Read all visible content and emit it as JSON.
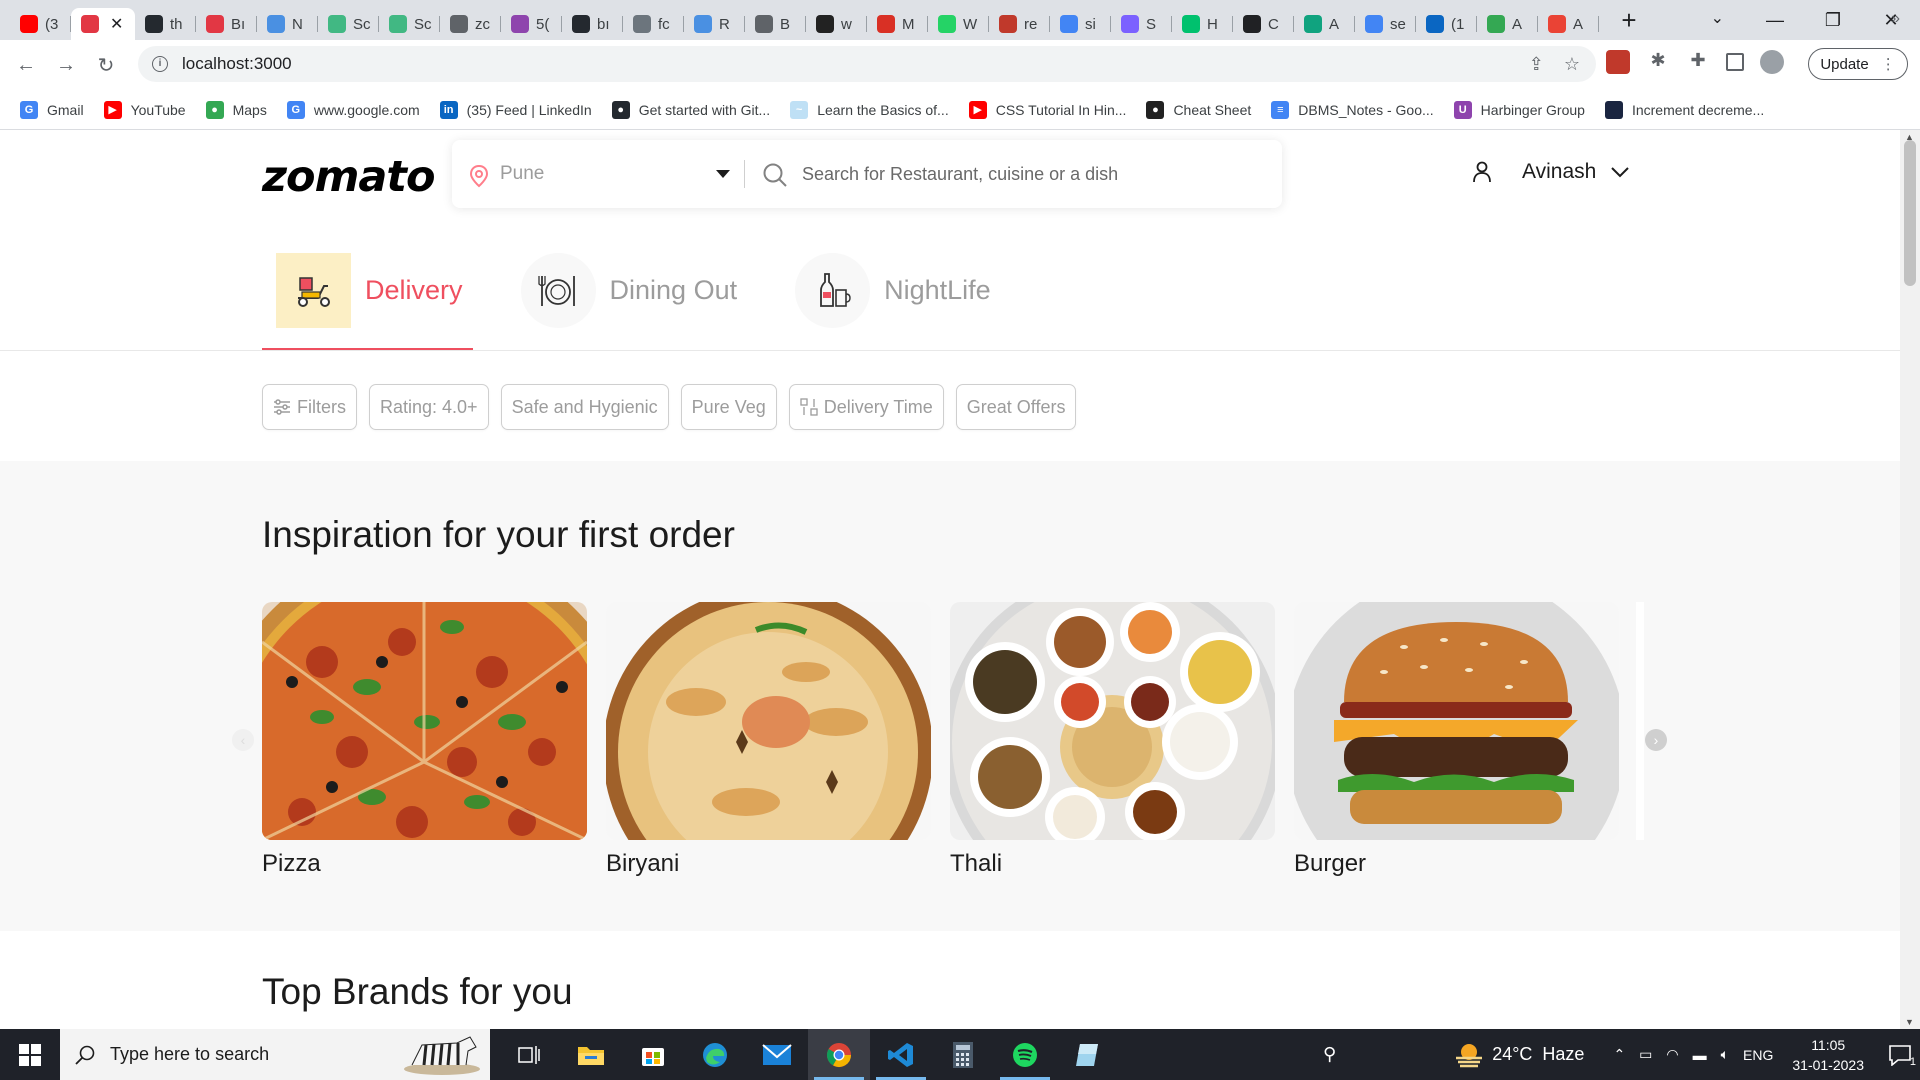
{
  "browser": {
    "tabs": [
      {
        "icon": "youtube-icon",
        "title": "(3",
        "color": "#ff0000"
      },
      {
        "icon": "zomato-icon",
        "title": "",
        "color": "#e23744",
        "active": true
      },
      {
        "icon": "github-icon",
        "title": "th",
        "color": "#24292f"
      },
      {
        "icon": "zomato-icon",
        "title": "Bı",
        "color": "#e23744"
      },
      {
        "icon": "multicolor-icon",
        "title": "N",
        "color": "#4a90e2"
      },
      {
        "icon": "vue-icon",
        "title": "Sc",
        "color": "#41b883"
      },
      {
        "icon": "vue-icon",
        "title": "Sc",
        "color": "#41b883"
      },
      {
        "icon": "globe-icon",
        "title": "zc",
        "color": "#5f6368"
      },
      {
        "icon": "purple-icon",
        "title": "5(",
        "color": "#8e44ad"
      },
      {
        "icon": "github-icon",
        "title": "bı",
        "color": "#24292f"
      },
      {
        "icon": "code-icon",
        "title": "fc",
        "color": "#6c757d"
      },
      {
        "icon": "multicolor-icon",
        "title": "R",
        "color": "#4a90e2"
      },
      {
        "icon": "globe-icon",
        "title": "B",
        "color": "#5f6368"
      },
      {
        "icon": "dark-icon",
        "title": "w",
        "color": "#222222"
      },
      {
        "icon": "red-outline-icon",
        "title": "M",
        "color": "#d93025"
      },
      {
        "icon": "whatsapp-icon",
        "title": "W",
        "color": "#25d366"
      },
      {
        "icon": "red-square-icon",
        "title": "re",
        "color": "#c0392b"
      },
      {
        "icon": "google-icon",
        "title": "si",
        "color": "#4285f4"
      },
      {
        "icon": "stack-icon",
        "title": "S",
        "color": "#7b61ff"
      },
      {
        "icon": "green-square-icon",
        "title": "H",
        "color": "#00c16e"
      },
      {
        "icon": "openai-icon",
        "title": "C",
        "color": "#202124"
      },
      {
        "icon": "openai-icon",
        "title": "A",
        "color": "#10a37f"
      },
      {
        "icon": "google-icon",
        "title": "se",
        "color": "#4285f4"
      },
      {
        "icon": "linkedin-icon",
        "title": "(1",
        "color": "#0a66c2"
      },
      {
        "icon": "drive-icon",
        "title": "A",
        "color": "#34a853"
      },
      {
        "icon": "gmail-icon",
        "title": "A",
        "color": "#ea4335"
      }
    ],
    "url": "localhost:3000",
    "update_label": "Update",
    "bookmarks": [
      {
        "icon": "google-icon",
        "label": "Gmail",
        "color": "#4285f4",
        "glyph": "G"
      },
      {
        "icon": "youtube-icon",
        "label": "YouTube",
        "color": "#ff0000",
        "glyph": "▶"
      },
      {
        "icon": "maps-icon",
        "label": "Maps",
        "color": "#34a853",
        "glyph": "●"
      },
      {
        "icon": "google-icon",
        "label": "www.google.com",
        "color": "#4285f4",
        "glyph": "G"
      },
      {
        "icon": "linkedin-icon",
        "label": "(35) Feed | LinkedIn",
        "color": "#0a66c2",
        "glyph": "in"
      },
      {
        "icon": "github-icon",
        "label": "Get started with Git...",
        "color": "#24292f",
        "glyph": "●"
      },
      {
        "icon": "learn-icon",
        "label": "Learn the Basics of...",
        "color": "#bfe0f5",
        "glyph": "~"
      },
      {
        "icon": "youtube-icon",
        "label": "CSS Tutorial In Hin...",
        "color": "#ff0000",
        "glyph": "▶"
      },
      {
        "icon": "cheat-sheet-icon",
        "label": "Cheat Sheet",
        "color": "#222222",
        "glyph": "●"
      },
      {
        "icon": "docs-icon",
        "label": "DBMS_Notes - Goo...",
        "color": "#4285f4",
        "glyph": "≡"
      },
      {
        "icon": "harbinger-icon",
        "label": "Harbinger Group",
        "color": "#8e44ad",
        "glyph": "U"
      },
      {
        "icon": "dark-icon",
        "label": "Increment decreme...",
        "color": "#1a2540",
        "glyph": ""
      }
    ]
  },
  "header": {
    "logo": "zomato",
    "location": "Pune",
    "search_placeholder": "Search for Restaurant, cuisine or a dish",
    "user_name": "Avinash"
  },
  "tabs": [
    {
      "label": "Delivery",
      "icon": "delivery-scooter-icon",
      "active": true
    },
    {
      "label": "Dining Out",
      "icon": "dining-plate-icon",
      "active": false
    },
    {
      "label": "NightLife",
      "icon": "nightlife-bottle-icon",
      "active": false
    }
  ],
  "filters": [
    {
      "label": "Filters",
      "icon": "filter-sliders-icon"
    },
    {
      "label": "Rating: 4.0+"
    },
    {
      "label": "Safe and Hygienic"
    },
    {
      "label": "Pure Veg"
    },
    {
      "label": "Delivery Time",
      "icon": "sort-icon"
    },
    {
      "label": "Great Offers"
    }
  ],
  "inspiration": {
    "title": "Inspiration for your first order",
    "items": [
      {
        "name": "Pizza",
        "icon": "pizza-image"
      },
      {
        "name": "Biryani",
        "icon": "biryani-image"
      },
      {
        "name": "Thali",
        "icon": "thali-image"
      },
      {
        "name": "Burger",
        "icon": "burger-image"
      }
    ]
  },
  "brands": {
    "title": "Top Brands for you"
  },
  "colors": {
    "accent": "#ef4f5f",
    "tab_bg": "#fcefc5",
    "muted": "#9c9c9c"
  },
  "taskbar": {
    "search_placeholder": "Type here to search",
    "weather": "24°C  Haze",
    "language": "ENG",
    "time": "11:05",
    "date": "31-01-2023",
    "notification_count": "1"
  }
}
